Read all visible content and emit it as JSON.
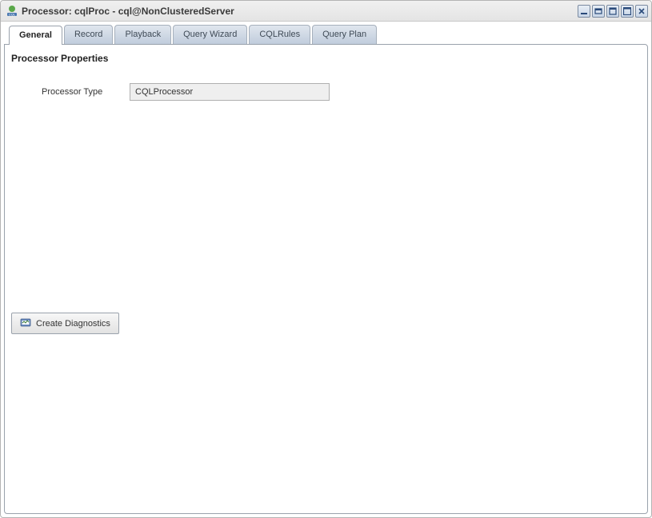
{
  "window": {
    "title": "Processor: cqlProc - cql@NonClusteredServer"
  },
  "tabs": [
    {
      "label": "General",
      "active": true
    },
    {
      "label": "Record",
      "active": false
    },
    {
      "label": "Playback",
      "active": false
    },
    {
      "label": "Query Wizard",
      "active": false
    },
    {
      "label": "CQLRules",
      "active": false
    },
    {
      "label": "Query Plan",
      "active": false
    }
  ],
  "general": {
    "section_title": "Processor Properties",
    "processor_type_label": "Processor Type",
    "processor_type_value": "CQLProcessor",
    "create_diagnostics_label": "Create Diagnostics"
  }
}
